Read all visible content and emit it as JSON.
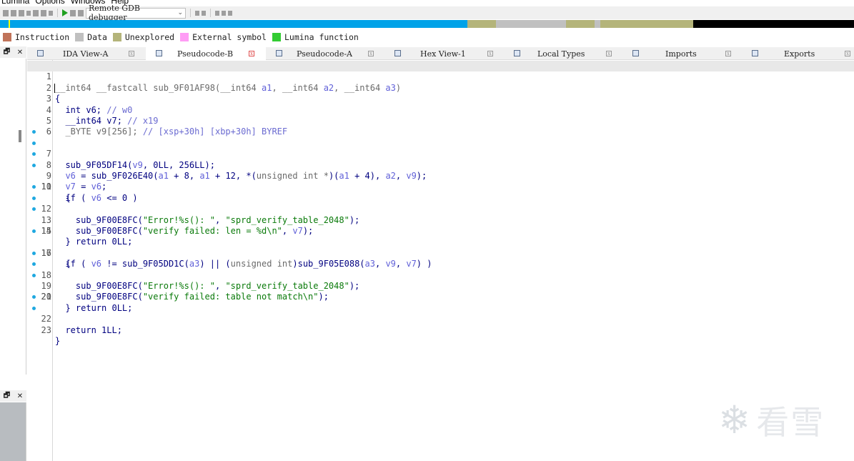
{
  "menu": [
    "Lumina",
    "Options",
    "Windows",
    "Help"
  ],
  "toolbar": {
    "debugger": "Remote GDB debugger"
  },
  "legend": [
    {
      "label": "Instruction",
      "color": "#c0735a"
    },
    {
      "label": "Data",
      "color": "#c0c0c0"
    },
    {
      "label": "Unexplored",
      "color": "#b4b47a"
    },
    {
      "label": "External symbol",
      "color": "#ff9cf5"
    },
    {
      "label": "Lumina function",
      "color": "#33cc33"
    }
  ],
  "tabs": [
    {
      "label": "IDA View-A",
      "active": false
    },
    {
      "label": "Pseudocode-B",
      "active": true
    },
    {
      "label": "Pseudocode-A",
      "active": false
    },
    {
      "label": "Hex View-1",
      "active": false
    },
    {
      "label": "Local Types",
      "active": false
    },
    {
      "label": "Imports",
      "active": false
    },
    {
      "label": "Exports",
      "active": false
    }
  ],
  "code": {
    "l1_a": "__int64 __fastcall sub_9F01AF98(__int64 ",
    "l1_p1": "a1",
    "l1_b": ", __int64 ",
    "l1_p2": "a2",
    "l1_c": ", __int64 ",
    "l1_p3": "a3",
    "l1_d": ")",
    "l2": "{",
    "l3_a": "  int v6; ",
    "l3_c": "// w0",
    "l4_a": "  __int64 v7; ",
    "l4_c": "// x19",
    "l5_a": "  _BYTE v9[256]; ",
    "l5_c": "// [xsp+30h] [xbp+30h] BYREF",
    "l7_a": "  sub_9F05DF14(",
    "l7_v": "v9",
    "l7_b": ", 0LL, 256LL);",
    "l8_v6": "v6",
    "l8_a": " = sub_9F026E40(",
    "l8_a1": "a1",
    "l8_b": " + 8, ",
    "l8_a1b": "a1",
    "l8_c": " + 12, *(",
    "l8_cast": "unsigned int *",
    "l8_d": ")(",
    "l8_a1c": "a1",
    "l8_e": " + 4), ",
    "l8_a2": "a2",
    "l8_f": ", ",
    "l8_v9": "v9",
    "l8_g": ");",
    "l9_v7": "v7",
    "l9_a": " = ",
    "l9_v6": "v6",
    "l9_b": ";",
    "l10_a": "  if ( ",
    "l10_v": "v6",
    "l10_b": " <= 0 )",
    "l11": "  {",
    "l12_a": "    sub_9F00E8FC(",
    "l12_s1": "\"Error!%s(): \"",
    "l12_b": ", ",
    "l12_s2": "\"sprd_verify_table_2048\"",
    "l12_c": ");",
    "l13_a": "    sub_9F00E8FC(",
    "l13_s": "\"verify failed: len = %d\\n\"",
    "l13_b": ", ",
    "l13_v": "v7",
    "l13_c": ");",
    "l14": "    return 0LL;",
    "l15": "  }",
    "l16_a": "  if ( ",
    "l16_v6": "v6",
    "l16_b": " != sub_9F05DD1C(",
    "l16_a3": "a3",
    "l16_c": ") || (",
    "l16_cast": "unsigned int",
    "l16_d": ")sub_9F05E088(",
    "l16_a3b": "a3",
    "l16_e": ", ",
    "l16_v9": "v9",
    "l16_f": ", ",
    "l16_v7": "v7",
    "l16_g": ") )",
    "l17": "  {",
    "l18_a": "    sub_9F00E8FC(",
    "l18_s1": "\"Error!%s(): \"",
    "l18_b": ", ",
    "l18_s2": "\"sprd_verify_table_2048\"",
    "l18_c": ");",
    "l19_a": "    sub_9F00E8FC(",
    "l19_s": "\"verify failed: table not match\\n\"",
    "l19_b": ");",
    "l20": "    return 0LL;",
    "l21": "  }",
    "l22": "  return 1LL;",
    "l23": "}"
  },
  "line_numbers": [
    "1",
    "2",
    "3",
    "4",
    "5",
    "6",
    "7",
    "8",
    "9",
    "10",
    "11",
    "12",
    "13",
    "14",
    "15",
    "16",
    "17",
    "18",
    "19",
    "20",
    "21",
    "22",
    "23"
  ],
  "watermark": {
    "text": "看雪",
    "icon": "snowflake-icon"
  }
}
